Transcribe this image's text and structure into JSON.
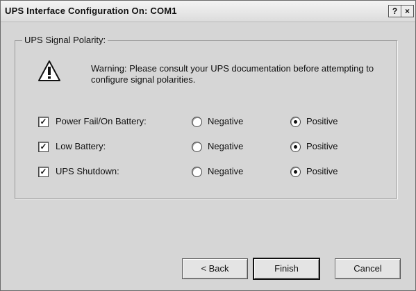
{
  "window": {
    "title": "UPS Interface Configuration On: COM1",
    "help_button": "?",
    "close_button": "×"
  },
  "group": {
    "label": "UPS Signal Polarity:",
    "warning_text": "Warning: Please consult your UPS documentation before attempting to configure signal polarities."
  },
  "signals": [
    {
      "label": "Power Fail/On Battery:",
      "enabled": true,
      "negative_label": "Negative",
      "positive_label": "Positive",
      "selected": "Positive"
    },
    {
      "label": "Low Battery:",
      "enabled": true,
      "negative_label": "Negative",
      "positive_label": "Positive",
      "selected": "Positive"
    },
    {
      "label": "UPS Shutdown:",
      "enabled": true,
      "negative_label": "Negative",
      "positive_label": "Positive",
      "selected": "Positive"
    }
  ],
  "buttons": {
    "back": "< Back",
    "finish": "Finish",
    "cancel": "Cancel"
  },
  "icons": {
    "warning": "warning-icon"
  }
}
